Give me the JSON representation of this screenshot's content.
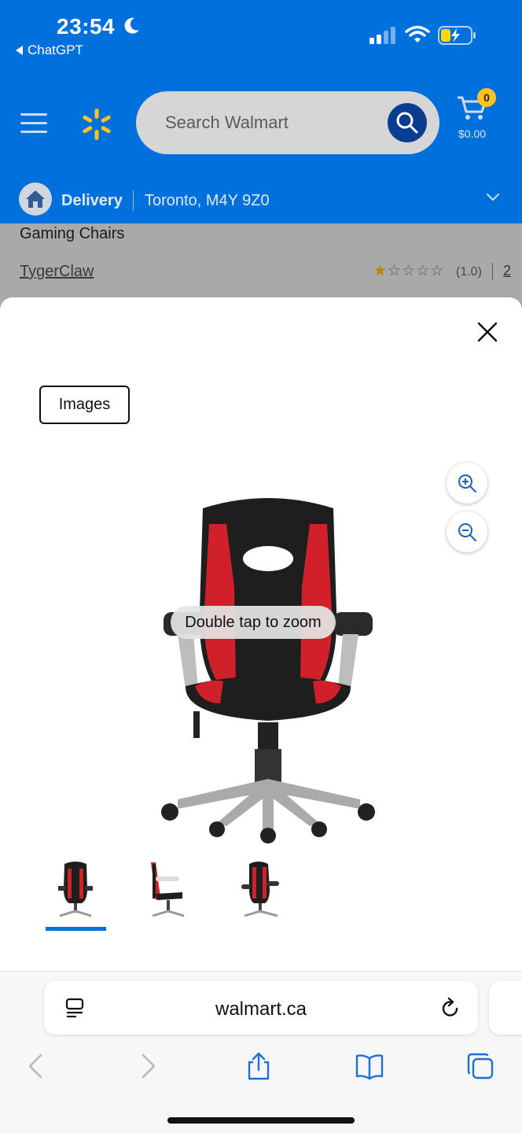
{
  "status_bar": {
    "time": "23:54",
    "back_app": "ChatGPT"
  },
  "header": {
    "search_placeholder": "Search Walmart",
    "cart_count": "0",
    "cart_total": "$0.00",
    "delivery_label": "Delivery",
    "location": "Toronto, M4Y 9Z0"
  },
  "product": {
    "category": "Gaming Chairs",
    "brand": "TygerClaw",
    "rating": "(1.0)",
    "rating_value": 1,
    "rating_max": 5,
    "review_count": "2"
  },
  "modal": {
    "images_tab": "Images",
    "zoom_tip": "Double tap to zoom",
    "thumbnails": [
      "chair-front",
      "chair-side",
      "chair-angle"
    ],
    "selected_thumbnail": 0
  },
  "browser": {
    "url": "walmart.ca"
  },
  "colors": {
    "walmart_blue": "#0071dc",
    "spark_yellow": "#ffc220",
    "chair_red": "#d0202a"
  }
}
